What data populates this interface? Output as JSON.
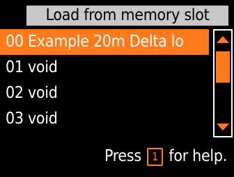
{
  "title": "Load from memory slot",
  "list": {
    "items": [
      {
        "label": "00 Example 20m Delta lo",
        "selected": true
      },
      {
        "label": "01 void",
        "selected": false
      },
      {
        "label": "02 void",
        "selected": false
      },
      {
        "label": "03 void",
        "selected": false
      }
    ]
  },
  "help": {
    "prefix": "Press",
    "key": "1",
    "suffix": "for help."
  },
  "colors": {
    "accent": "#ff7a1a",
    "title_bg": "#c8c8c8",
    "background": "#000000",
    "text": "#ffffff"
  },
  "icons": {
    "scroll_up": "triangle-up-icon",
    "scroll_down": "triangle-down-icon"
  }
}
